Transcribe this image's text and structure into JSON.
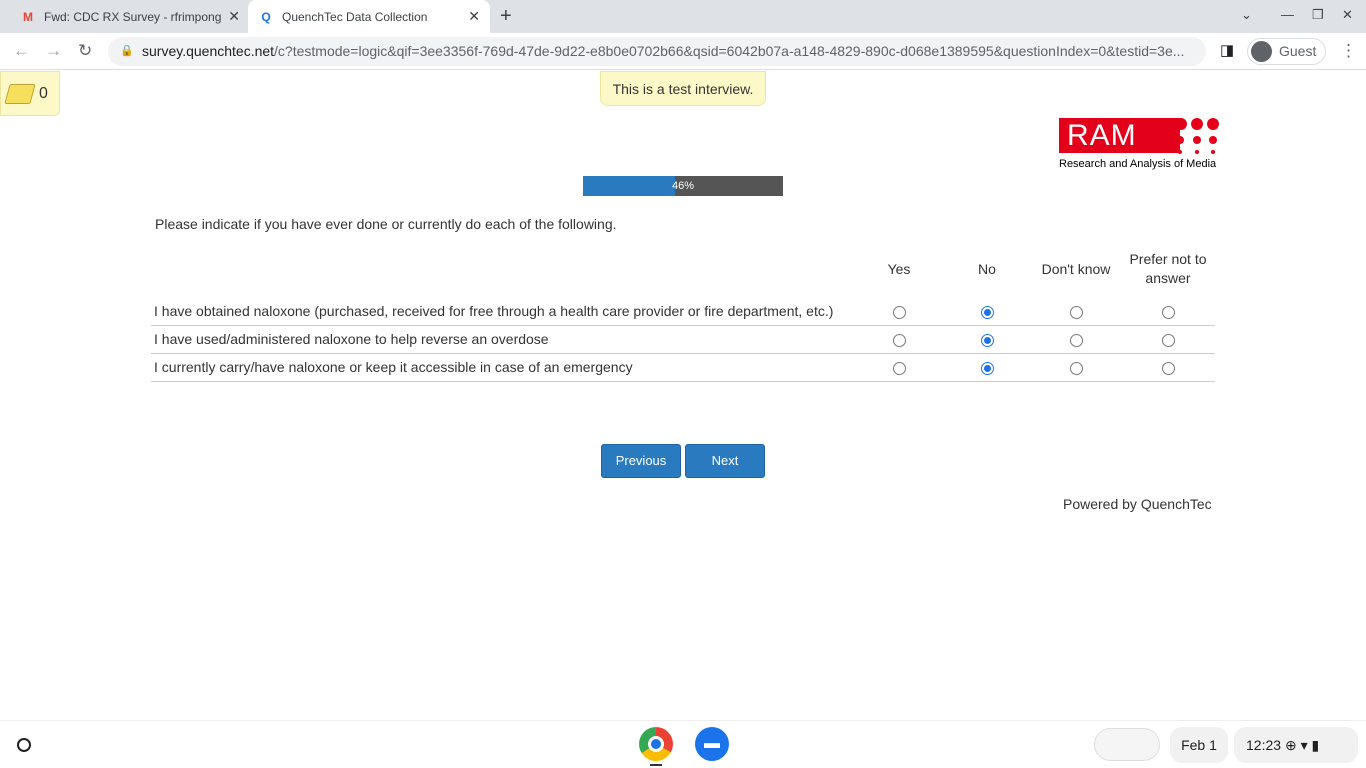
{
  "browser": {
    "tabs": [
      {
        "label": "Fwd: CDC RX Survey - rfrimpong",
        "icon": "gmail-icon"
      },
      {
        "label": "QuenchTec Data Collection",
        "icon": "quenchtec-icon"
      }
    ],
    "url_host": "survey.quenchtec.net",
    "url_path": "/c?testmode=logic&qif=3ee3356f-769d-47de-9d22-e8b0e0702b66&qsid=6042b07a-a148-4829-890c-d068e1389595&questionIndex=0&testid=3e...",
    "profile": "Guest"
  },
  "notes": {
    "count": "0"
  },
  "banner": "This is a test interview.",
  "logo": {
    "text": "RAM",
    "subtitle": "Research and Analysis of Media",
    "color": "#e2001a"
  },
  "progress": {
    "value": 46,
    "label": "46%"
  },
  "question": "Please indicate if you have ever done or currently do each of the following.",
  "columns": [
    "Yes",
    "No",
    "Don't know",
    "Prefer not to answer"
  ],
  "rows": [
    {
      "label": "I have obtained naloxone (purchased, received for free through a health care provider or fire department, etc.)",
      "selected": 1
    },
    {
      "label": "I have used/administered naloxone to help reverse an overdose",
      "selected": 1
    },
    {
      "label": "I currently carry/have naloxone or keep it accessible in case of an emergency",
      "selected": 1
    }
  ],
  "buttons": {
    "previous": "Previous",
    "next": "Next"
  },
  "footer": "Powered by QuenchTec",
  "shelf": {
    "date": "Feb 1",
    "time": "12:23"
  }
}
